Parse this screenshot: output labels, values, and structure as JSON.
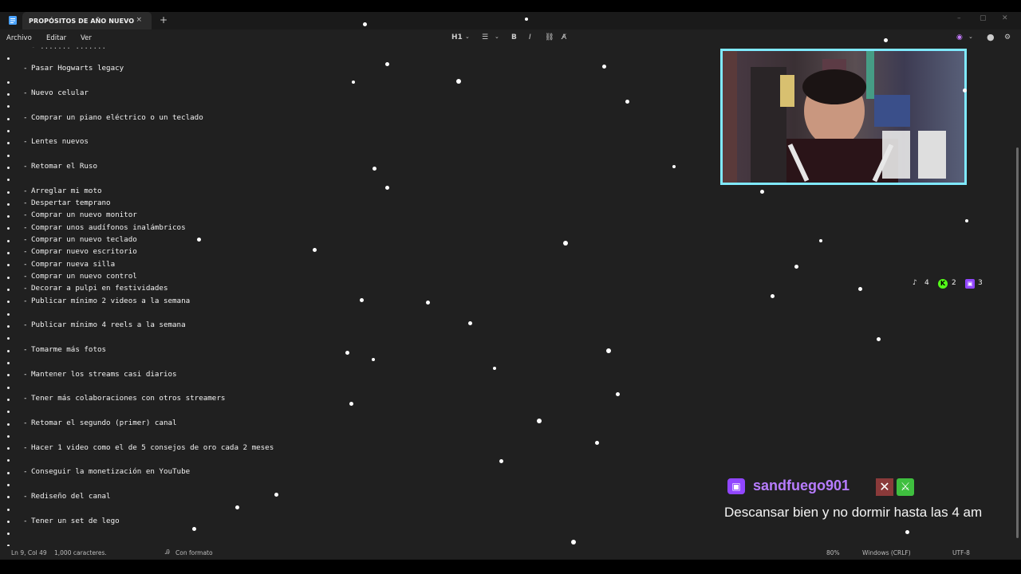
{
  "window": {
    "tab_title": "PROPÓSITOS DE AÑO NUEVO",
    "close_glyph": "×",
    "new_tab_glyph": "+",
    "controls": [
      "–",
      "▢",
      "✕"
    ]
  },
  "menu": {
    "items": [
      "Archivo",
      "Editar",
      "Ver"
    ]
  },
  "toolbar": {
    "heading": "H1",
    "list": "☰",
    "bold": "B",
    "italic": "I",
    "link": "⛓",
    "clear_format": "A̸",
    "copilot": "◉",
    "account": "●",
    "settings": "⚙"
  },
  "document": {
    "lines": [
      {
        "text": "Pasar Hogwarts legacy",
        "dash": true
      },
      {
        "text": "Nuevo celular",
        "dash": true
      },
      {
        "text": "Comprar un piano eléctrico o un teclado",
        "dash": true
      },
      {
        "text": "Lentes nuevos",
        "dash": true
      },
      {
        "text": "Retomar el Ruso",
        "dash": true
      },
      {
        "text": "Arreglar mi moto",
        "dash": true
      },
      {
        "text": "Despertar temprano",
        "dash": true
      },
      {
        "text": "Comprar un nuevo monitor",
        "dash": true
      },
      {
        "text": "Comprar unos audífonos inalámbricos",
        "dash": true
      },
      {
        "text": "Comprar un nuevo teclado",
        "dash": true
      },
      {
        "text": "Comprar nuevo escritorio",
        "dash": true
      },
      {
        "text": "Comprar nueva silla",
        "dash": true
      },
      {
        "text": "Comprar un nuevo control",
        "dash": true
      },
      {
        "text": "Decorar a pulpi en festividades",
        "dash": true
      },
      {
        "text": "Publicar mínimo 2 videos a la semana",
        "dash": true
      },
      {
        "text": "Publicar mínimo 4 reels a la semana",
        "dash": true
      },
      {
        "text": "Tomarme más fotos",
        "dash": true
      },
      {
        "text": "Mantener los streams casi diarios",
        "dash": true
      },
      {
        "text": "Tener más colaboraciones con otros streamers",
        "dash": true
      },
      {
        "text": "Retomar el segundo (primer) canal",
        "dash": true
      },
      {
        "text": "Hacer 1 video como el de 5 consejos de oro cada 2 meses",
        "dash": true
      },
      {
        "text": "Conseguir la monetización en YouTube",
        "dash": true
      },
      {
        "text": "Rediseño del canal",
        "dash": true
      },
      {
        "text": "Tener un set de lego",
        "dash": true
      }
    ]
  },
  "status": {
    "position": "Ln 9, Col 49",
    "chars": "1,000 caracteres.",
    "format": "Con formato",
    "zoom": "80%",
    "line_endings": "Windows (CRLF)",
    "encoding": "UTF-8"
  },
  "overlay": {
    "social": [
      {
        "icon": "tiktok-icon",
        "count": "4"
      },
      {
        "icon": "kick-icon",
        "count": "2"
      },
      {
        "icon": "twitch-icon",
        "count": "3"
      }
    ],
    "chat": {
      "username": "sandfuego901",
      "message": "Descansar bien y no dormir hasta las 4 am"
    }
  },
  "colors": {
    "background": "#202020",
    "text": "#f2f2f2",
    "webcam_border": "#7fe9ff",
    "twitch_purple": "#9146ff",
    "chat_username": "#b77cff"
  }
}
